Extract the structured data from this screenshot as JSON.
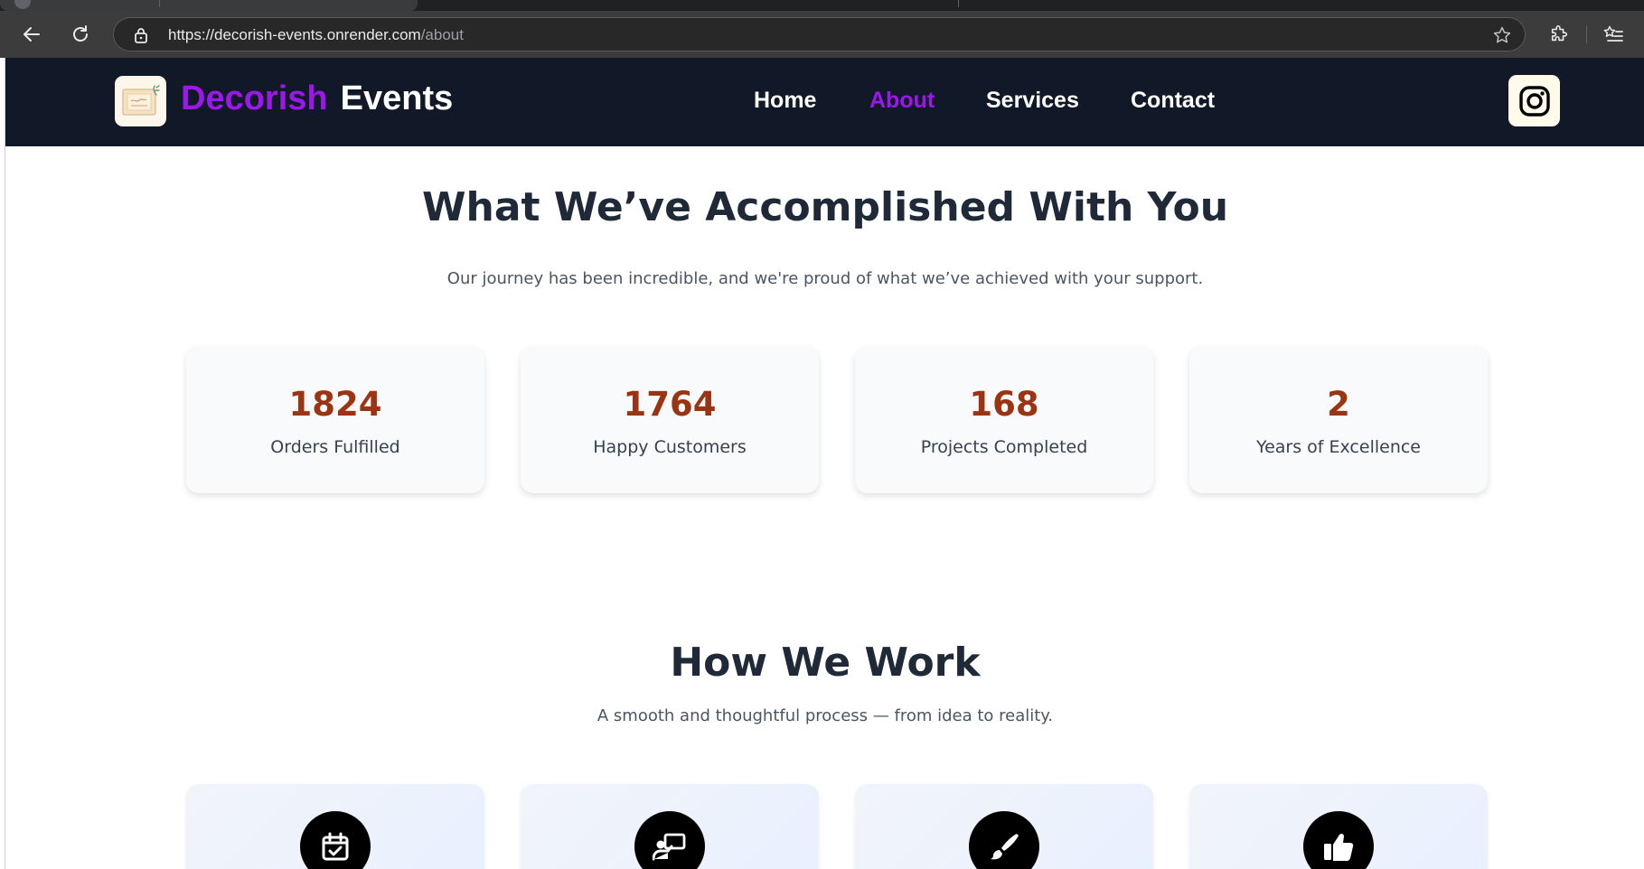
{
  "browser": {
    "url_host": "https://decorish-events.onrender.com",
    "url_path": "/about"
  },
  "navbar": {
    "brand_first": "Decorish",
    "brand_second": "Events",
    "links": [
      {
        "label": "Home",
        "active": false
      },
      {
        "label": "About",
        "active": true
      },
      {
        "label": "Services",
        "active": false
      },
      {
        "label": "Contact",
        "active": false
      }
    ],
    "accent_color": "#9b18e8",
    "background_color": "#111827"
  },
  "accomplished": {
    "title": "What We’ve Accomplished With You",
    "subtitle": "Our journey has been incredible, and we're proud of what we’ve achieved with your support.",
    "stats": [
      {
        "value": "1824",
        "label": "Orders Fulfilled"
      },
      {
        "value": "1764",
        "label": "Happy Customers"
      },
      {
        "value": "168",
        "label": "Projects Completed"
      },
      {
        "value": "2",
        "label": "Years of Excellence"
      }
    ],
    "number_color": "#9a3412"
  },
  "how_we_work": {
    "title": "How We Work",
    "subtitle": "A smooth and thoughtful process — from idea to reality.",
    "steps": [
      {
        "icon": "calendar-check-icon"
      },
      {
        "icon": "presentation-user-icon"
      },
      {
        "icon": "paint-brush-icon"
      },
      {
        "icon": "thumbs-up-icon"
      }
    ]
  }
}
